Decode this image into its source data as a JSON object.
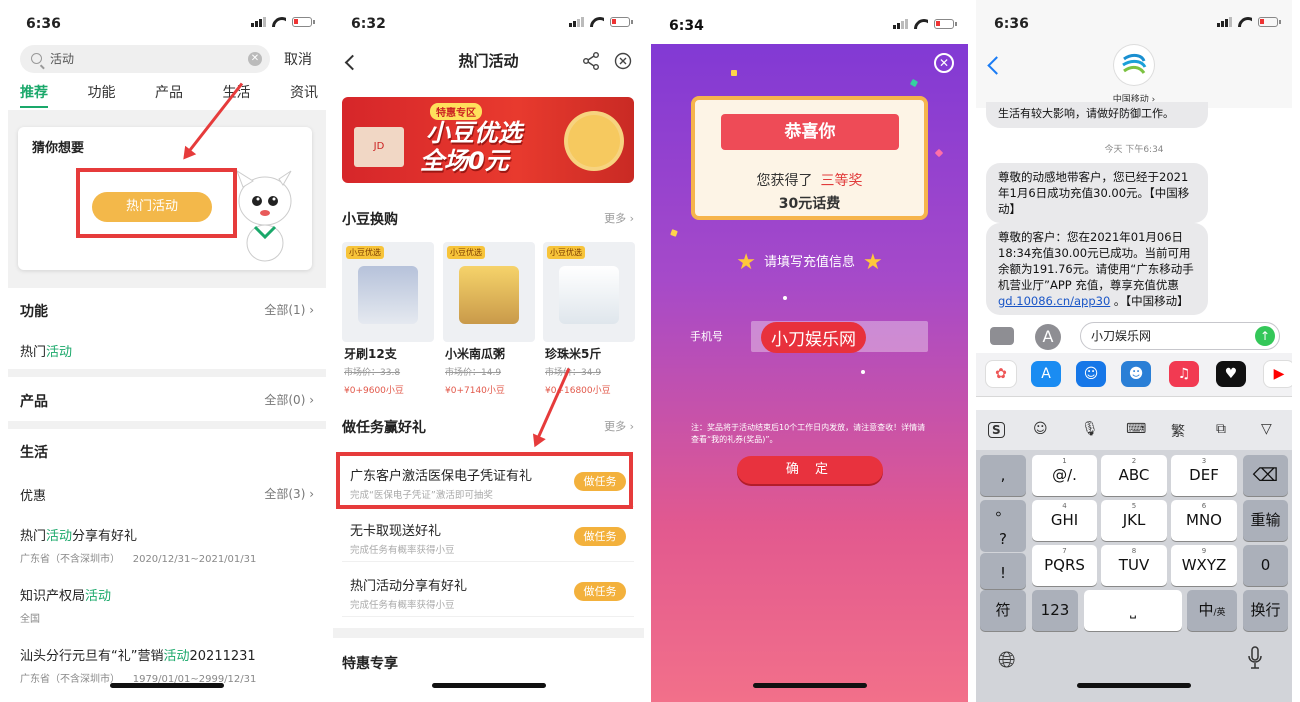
{
  "p1": {
    "time": "6:36",
    "search_value": "活动",
    "cancel": "取消",
    "tabs": [
      "推荐",
      "功能",
      "产品",
      "生活",
      "资讯"
    ],
    "guess_title": "猜你想要",
    "hot_button": "热门活动",
    "func_title": "功能",
    "func_count": "全部(1)",
    "func_item_a": "热门",
    "func_item_b": "活动",
    "prod_title": "产品",
    "prod_count": "全部(0)",
    "life_title": "生活",
    "promo_title": "优惠",
    "promo_count": "全部(3)",
    "items": [
      {
        "a": "热门",
        "b": "活动",
        "c": "分享有好礼",
        "region": "广东省（不含深圳市）",
        "date": "2020/12/31~2021/01/31"
      },
      {
        "a": "知识产权局",
        "b": "活动",
        "c": "",
        "region": "全国",
        "date": ""
      },
      {
        "a": "汕头分行元旦有“礼”营销",
        "b": "活动",
        "c": "20211231",
        "region": "广东省（不含深圳市）",
        "date": "1979/01/01~2999/12/31"
      }
    ]
  },
  "p2": {
    "time": "6:32",
    "title": "热门活动",
    "banner_badge": "特惠专区",
    "banner_line1": "小豆优选",
    "banner_line2": "全场0元",
    "banner_jd": "JD",
    "exchange_title": "小豆换购",
    "more": "更多",
    "products": [
      {
        "brand": "小豆优选",
        "name": "牙刷12支",
        "old": "市场价：33.8",
        "price": "¥0+9600小豆",
        "color": "#d9dee8"
      },
      {
        "brand": "小豆优选",
        "name": "小米南瓜粥",
        "old": "市场价：14.9",
        "price": "¥0+7140小豆",
        "color": "#f2d889"
      },
      {
        "brand": "小豆优选",
        "name": "珍珠米5斤",
        "old": "市场价：34.9",
        "price": "¥0+16800小豆",
        "color": "#e9eef3"
      }
    ],
    "tasks_title": "做任务赢好礼",
    "tasks": [
      {
        "title": "广东客户激活医保电子凭证有礼",
        "sub": "完成“医保电子凭证”激活即可抽奖",
        "btn": "做任务"
      },
      {
        "title": "无卡取现送好礼",
        "sub": "完成任务有概率获得小豆",
        "btn": "做任务"
      },
      {
        "title": "热门活动分享有好礼",
        "sub": "完成任务有概率获得小豆",
        "btn": "做任务"
      }
    ],
    "special_title": "特惠专享"
  },
  "p3": {
    "time": "6:34",
    "congrats": "恭喜你",
    "line1": "您获得了",
    "prize_level": "三等奖",
    "line2": "30元话费",
    "fill_info": "请填写充值信息",
    "phone_label": "手机号",
    "watermark": "小刀娱乐网",
    "note": "注：奖品将于活动结束后10个工作日内发放，请注意查收！详情请查看“我的礼券(奖品)”。",
    "confirm": "确 定"
  },
  "p4": {
    "time": "6:36",
    "contact": "中国移动",
    "prev_msg": "生活有较大影响，请做好防御工作。",
    "timestamp": "今天 下午6:34",
    "msg1": "尊敬的动感地带客户，您已经于2021年1月6日成功充值30.00元。【中国移动】",
    "msg2a": "尊敬的客户：您在2021年01月06日18:34充值30.00元已成功。当前可用余额为191.76元。请使用“广东移动手机营业厅”APP 充值，尊享充值优惠",
    "msg2_link": "gd.10086.cn/app30",
    "msg2b": "。【中国移动】",
    "input_text": "小刀娱乐网",
    "kb_toolbar": [
      "繁"
    ],
    "keys_left": [
      ",",
      "。",
      "?",
      "!"
    ],
    "keys_main": [
      {
        "n": "1",
        "t": "@/."
      },
      {
        "n": "2",
        "t": "ABC"
      },
      {
        "n": "3",
        "t": "DEF"
      },
      {
        "n": "4",
        "t": "GHI"
      },
      {
        "n": "5",
        "t": "JKL"
      },
      {
        "n": "6",
        "t": "MNO"
      },
      {
        "n": "7",
        "t": "PQRS"
      },
      {
        "n": "8",
        "t": "TUV"
      },
      {
        "n": "9",
        "t": "WXYZ"
      }
    ],
    "key_reenter": "重输",
    "key_zero": "0",
    "key_symbol": "符",
    "key_123": "123",
    "key_lang": "中",
    "key_lang_sub": "/英",
    "key_return": "换行"
  }
}
